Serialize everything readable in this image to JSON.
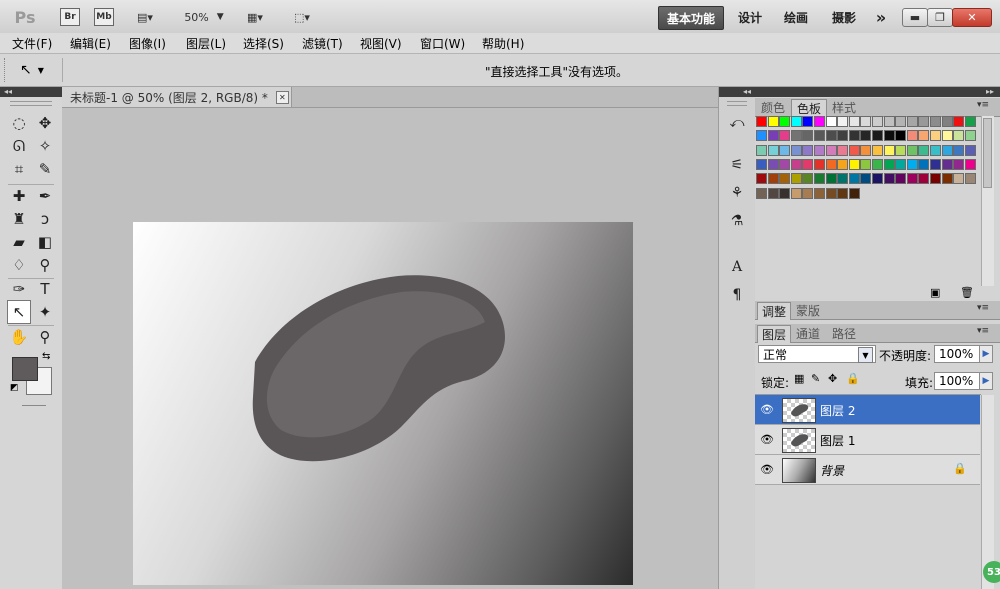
{
  "appbar": {
    "logo": "Ps",
    "bridge_label": "Br",
    "minibridge_label": "Mb",
    "zoom": "50%",
    "workspaces": [
      "基本功能",
      "设计",
      "绘画",
      "摄影"
    ],
    "more": "»"
  },
  "menu": [
    "文件(F)",
    "编辑(E)",
    "图像(I)",
    "图层(L)",
    "选择(S)",
    "滤镜(T)",
    "视图(V)",
    "窗口(W)",
    "帮助(H)"
  ],
  "options": {
    "message": "\"直接选择工具\"没有选项。"
  },
  "document": {
    "title": "未标题-1 @ 50% (图层 2, RGB/8) *",
    "close": "✕"
  },
  "colors": {
    "accent": "#3a6fc4",
    "foreground": "#5f5b5c",
    "background_swatch": "#f3f3f3",
    "shape_fill": "#5a5556"
  },
  "swatch_panel": {
    "tabs": [
      "颜色",
      "色板",
      "样式"
    ],
    "active_tab": "色板",
    "swatches": [
      [
        "#ff0000",
        "#ffff00",
        "#00ff00",
        "#00ffff",
        "#0000ff",
        "#ff00ff",
        "#ffffff",
        "#f2f2f2",
        "#e6e6e6",
        "#d9d9d9",
        "#cccccc",
        "#bfbfbf",
        "#b3b3b3",
        "#a6a6a6",
        "#999999",
        "#8c8c8c",
        "#808080",
        "#ee1111",
        "#16a04a"
      ],
      [
        "#1e90ff",
        "#7a3db8",
        "#e63c8c",
        "#737373",
        "#666666",
        "#595959",
        "#4d4d4d",
        "#404040",
        "#333333",
        "#262626",
        "#1a1a1a",
        "#0d0d0d",
        "#000000",
        "#f28c78",
        "#f6a66e",
        "#fbcf7f",
        "#fff59a",
        "#c9e39a",
        "#8fd18f"
      ],
      [
        "#7ccbb0",
        "#75d0d8",
        "#6eb8e8",
        "#7891d0",
        "#8e78c8",
        "#b17bc7",
        "#d27cb9",
        "#e87b91",
        "#f15a4a",
        "#f3903b",
        "#f9c03f",
        "#fff35c",
        "#b8dc5a",
        "#6fc264",
        "#3dbb8e",
        "#38bec7",
        "#2ea7e0",
        "#3e78c1",
        "#5b5fb3"
      ],
      [
        "#3a5ec0",
        "#7a4db2",
        "#a348a6",
        "#c63f8c",
        "#e23b6b",
        "#e53228",
        "#f26a21",
        "#f7a41d",
        "#fff200",
        "#8dc63f",
        "#39b54a",
        "#00a651",
        "#00a99d",
        "#00aeef",
        "#0072bc",
        "#2e3192",
        "#662d91",
        "#92278f",
        "#ec008c"
      ],
      [
        "#9e0b0f",
        "#a0410d",
        "#a36209",
        "#aba000",
        "#598527",
        "#1a7b30",
        "#007236",
        "#00746b",
        "#0076a3",
        "#004b80",
        "#1b1464",
        "#440e62",
        "#630460",
        "#9e005d",
        "#9e0039",
        "#790000",
        "#7b2e00",
        "#c7b299",
        "#998675"
      ],
      [
        "#736357",
        "#534741",
        "#37302d",
        "#c69c6d",
        "#a67c52",
        "#8c6239",
        "#754c24",
        "#603913",
        "#42210b"
      ]
    ]
  },
  "layers_panel": {
    "top_tabs": [
      "调整",
      "蒙版"
    ],
    "tabs": [
      "图层",
      "通道",
      "路径"
    ],
    "blend_mode": "正常",
    "opacity_label": "不透明度:",
    "opacity": "100%",
    "lock_label": "锁定:",
    "fill_label": "填充:",
    "fill": "100%",
    "layers": [
      {
        "name": "图层 2",
        "selected": true
      },
      {
        "name": "图层 1",
        "selected": false
      },
      {
        "name": "背景",
        "selected": false,
        "locked": true
      }
    ]
  },
  "badge": "53"
}
